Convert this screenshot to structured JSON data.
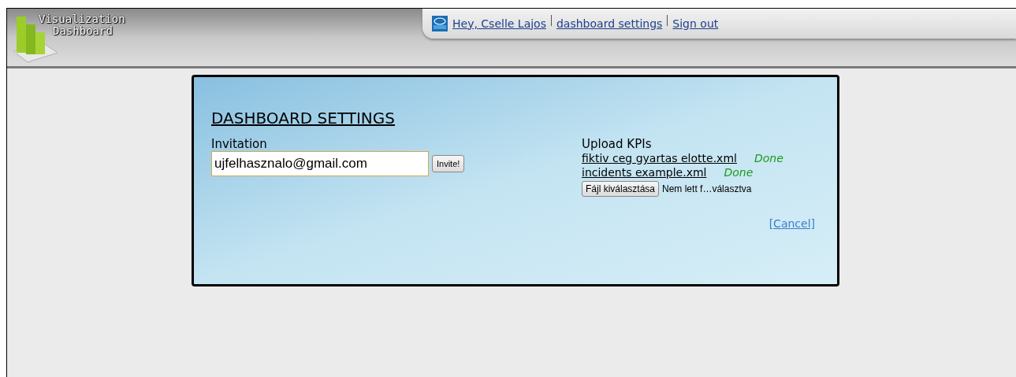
{
  "header": {
    "logo_line1": "Visualization",
    "logo_line2": "Dashboard",
    "nav": [
      {
        "label": "Hey, Cselle Lajos"
      },
      {
        "label": "dashboard settings"
      },
      {
        "label": "Sign out"
      }
    ]
  },
  "dialog": {
    "title": "DASHBOARD SETTINGS",
    "invitation": {
      "label": "Invitation",
      "value": "ujfelhasznalo@gmail.com",
      "button": "Invite!"
    },
    "upload": {
      "label": "Upload KPIs",
      "files": [
        {
          "name": "fiktiv ceg gyartas elotte.xml",
          "status": "Done"
        },
        {
          "name": "incidents example.xml",
          "status": "Done"
        }
      ],
      "choose_button": "Fájl kiválasztása",
      "choose_status": "Nem lett f…választva"
    },
    "cancel": "[Cancel]"
  }
}
